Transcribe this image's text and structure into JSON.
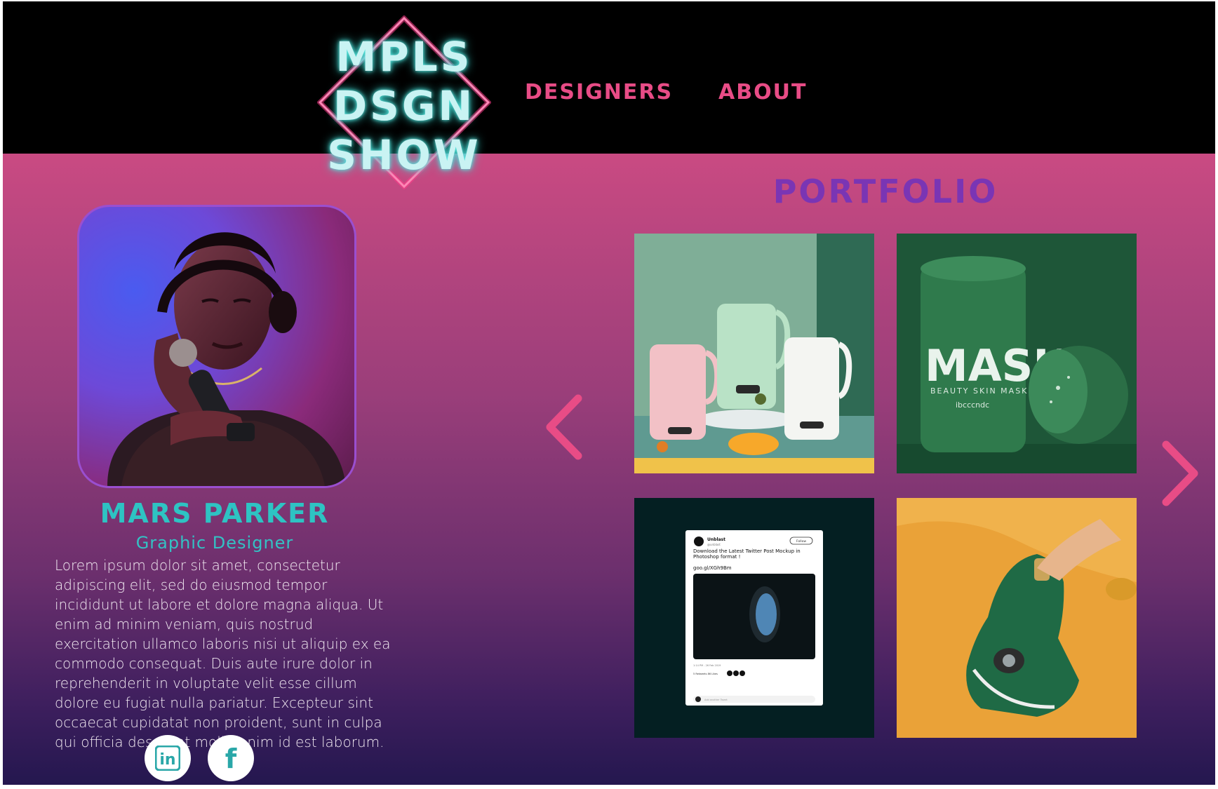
{
  "header": {
    "logo_lines": [
      "MPLS",
      "DSGN",
      "SHOW"
    ],
    "nav": [
      {
        "label": "DESIGNERS"
      },
      {
        "label": "ABOUT"
      }
    ]
  },
  "portfolio": {
    "title": "PORTFOLIO",
    "tiles": [
      {
        "subject": "kettle-product-photo"
      },
      {
        "subject": "mask-product-photo",
        "text": "MASK",
        "subtext": "BEAUTY SKIN MASK",
        "brand": "ibcccndc"
      },
      {
        "subject": "tweet-mockup",
        "tweet_user": "Unblast",
        "tweet_handle": "@unblast",
        "tweet_text": "Download the Latest Twitter Post Mockup in Photoshop format !",
        "tweet_link": "goo.gl/XGh9Bm",
        "tweet_time": "1:14 PM - 26 Feb 2019",
        "tweet_stats": "5 Retweets   86 Likes",
        "follow_label": "Follow",
        "reply_placeholder": "Add another Tweet"
      },
      {
        "subject": "steam-iron-product-photo"
      }
    ]
  },
  "profile": {
    "name": "MARS PARKER",
    "role": "Graphic  Designer",
    "bio": "Lorem ipsum dolor sit amet, consectetur adipiscing elit, sed do eiusmod tempor incididunt ut labore et dolore magna aliqua. Ut enim ad minim veniam, quis nostrud exercitation ullamco laboris nisi ut aliquip ex ea commodo consequat. Duis aute irure dolor in reprehenderit in voluptate velit esse cillum dolore eu fugiat nulla pariatur. Excepteur sint occaecat cupidatat non proident, sunt in culpa qui officia deserunt mollit anim id est laborum.",
    "social": [
      {
        "icon": "linkedin-icon",
        "label": "in"
      },
      {
        "icon": "facebook-icon",
        "label": "f"
      }
    ]
  },
  "colors": {
    "accent_pink": "#e84c86",
    "accent_teal": "#2ec3c3",
    "portfolio_purple": "#7a35b4"
  }
}
